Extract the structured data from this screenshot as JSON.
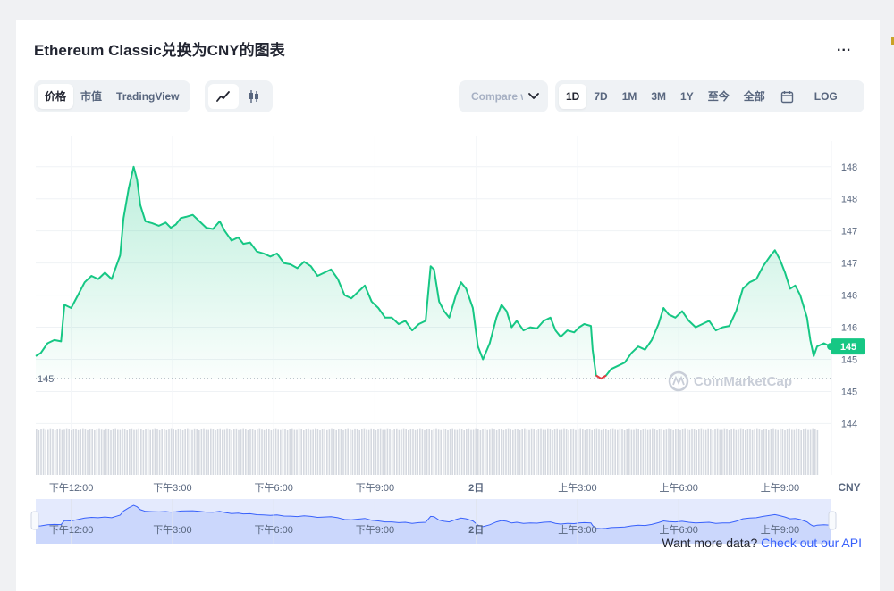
{
  "title": "Ethereum Classic兑换为CNY的图表",
  "more_label": "...",
  "type_tabs": [
    "价格",
    "市值",
    "TradingView"
  ],
  "compare_label": "Compare with",
  "range_tabs": [
    "1D",
    "7D",
    "1M",
    "3M",
    "1Y",
    "至今",
    "全部"
  ],
  "log_label": "LOG",
  "icons": {
    "line": "line-chart-icon",
    "candle": "candlestick-icon",
    "calendar": "calendar-icon",
    "chevron": "chevron-down-icon"
  },
  "colors": {
    "up": "#16c784",
    "down": "#ea3943",
    "accent": "#3861fb"
  },
  "footer": {
    "prefix": "Want more data? ",
    "link": "Check out our API"
  },
  "watermark": "CoinMarketCap",
  "chart_data": {
    "type": "area",
    "currency": "CNY",
    "y_ticks": [
      "148",
      "148",
      "147",
      "147",
      "146",
      "146",
      "145",
      "145",
      "144"
    ],
    "y_tick_values": [
      148.3,
      147.8,
      147.3,
      146.8,
      146.3,
      145.8,
      145.3,
      144.8,
      144.3
    ],
    "ylim": [
      144.0,
      148.7
    ],
    "baseline_label": "145",
    "baseline_value": 145.0,
    "current_label": "145",
    "x_ticks": [
      "下午12:00",
      "下午3:00",
      "下午6:00",
      "下午9:00",
      "2日",
      "上午3:00",
      "上午6:00",
      "上午9:00"
    ],
    "x_tick_hours": [
      2,
      5,
      8,
      11,
      14,
      17,
      20,
      23
    ],
    "x_range_hours": [
      0.95,
      24.1
    ],
    "grid": true,
    "series": [
      {
        "points": [
          [
            0.95,
            145.35
          ],
          [
            1.1,
            145.4
          ],
          [
            1.3,
            145.55
          ],
          [
            1.5,
            145.6
          ],
          [
            1.7,
            145.58
          ],
          [
            1.8,
            146.15
          ],
          [
            2.0,
            146.1
          ],
          [
            2.2,
            146.3
          ],
          [
            2.4,
            146.5
          ],
          [
            2.6,
            146.6
          ],
          [
            2.8,
            146.55
          ],
          [
            3.0,
            146.65
          ],
          [
            3.2,
            146.55
          ],
          [
            3.3,
            146.7
          ],
          [
            3.45,
            146.92
          ],
          [
            3.55,
            147.5
          ],
          [
            3.7,
            147.95
          ],
          [
            3.85,
            148.3
          ],
          [
            3.95,
            148.1
          ],
          [
            4.05,
            147.7
          ],
          [
            4.2,
            147.45
          ],
          [
            4.4,
            147.42
          ],
          [
            4.6,
            147.38
          ],
          [
            4.8,
            147.43
          ],
          [
            4.95,
            147.35
          ],
          [
            5.1,
            147.4
          ],
          [
            5.25,
            147.5
          ],
          [
            5.4,
            147.52
          ],
          [
            5.6,
            147.55
          ],
          [
            5.8,
            147.45
          ],
          [
            6.0,
            147.35
          ],
          [
            6.2,
            147.33
          ],
          [
            6.4,
            147.45
          ],
          [
            6.55,
            147.3
          ],
          [
            6.75,
            147.15
          ],
          [
            6.95,
            147.2
          ],
          [
            7.1,
            147.1
          ],
          [
            7.3,
            147.12
          ],
          [
            7.5,
            146.98
          ],
          [
            7.7,
            146.95
          ],
          [
            7.9,
            146.9
          ],
          [
            8.1,
            146.95
          ],
          [
            8.3,
            146.8
          ],
          [
            8.5,
            146.78
          ],
          [
            8.7,
            146.72
          ],
          [
            8.9,
            146.82
          ],
          [
            9.1,
            146.75
          ],
          [
            9.3,
            146.6
          ],
          [
            9.5,
            146.65
          ],
          [
            9.7,
            146.7
          ],
          [
            9.9,
            146.55
          ],
          [
            10.1,
            146.3
          ],
          [
            10.3,
            146.25
          ],
          [
            10.5,
            146.35
          ],
          [
            10.7,
            146.45
          ],
          [
            10.9,
            146.2
          ],
          [
            11.1,
            146.1
          ],
          [
            11.3,
            145.95
          ],
          [
            11.5,
            145.95
          ],
          [
            11.7,
            145.85
          ],
          [
            11.9,
            145.9
          ],
          [
            12.1,
            145.75
          ],
          [
            12.3,
            145.85
          ],
          [
            12.5,
            145.9
          ],
          [
            12.65,
            146.75
          ],
          [
            12.75,
            146.7
          ],
          [
            12.9,
            146.2
          ],
          [
            13.05,
            146.05
          ],
          [
            13.2,
            145.95
          ],
          [
            13.4,
            146.3
          ],
          [
            13.55,
            146.5
          ],
          [
            13.7,
            146.4
          ],
          [
            13.9,
            146.1
          ],
          [
            14.05,
            145.5
          ],
          [
            14.2,
            145.3
          ],
          [
            14.4,
            145.55
          ],
          [
            14.6,
            145.95
          ],
          [
            14.75,
            146.15
          ],
          [
            14.9,
            146.05
          ],
          [
            15.05,
            145.8
          ],
          [
            15.2,
            145.9
          ],
          [
            15.4,
            145.75
          ],
          [
            15.6,
            145.8
          ],
          [
            15.8,
            145.78
          ],
          [
            16.0,
            145.9
          ],
          [
            16.2,
            145.95
          ],
          [
            16.35,
            145.75
          ],
          [
            16.5,
            145.65
          ],
          [
            16.7,
            145.75
          ],
          [
            16.9,
            145.72
          ],
          [
            17.05,
            145.8
          ],
          [
            17.2,
            145.85
          ],
          [
            17.4,
            145.82
          ],
          [
            17.45,
            145.45
          ],
          [
            17.55,
            145.05
          ],
          [
            17.7,
            145.0
          ],
          [
            17.85,
            145.05
          ],
          [
            18.0,
            145.15
          ],
          [
            18.2,
            145.2
          ],
          [
            18.4,
            145.25
          ],
          [
            18.6,
            145.4
          ],
          [
            18.8,
            145.5
          ],
          [
            19.0,
            145.45
          ],
          [
            19.2,
            145.6
          ],
          [
            19.4,
            145.85
          ],
          [
            19.55,
            146.1
          ],
          [
            19.7,
            146.0
          ],
          [
            19.9,
            145.95
          ],
          [
            20.1,
            146.05
          ],
          [
            20.3,
            145.9
          ],
          [
            20.5,
            145.8
          ],
          [
            20.7,
            145.85
          ],
          [
            20.9,
            145.9
          ],
          [
            21.1,
            145.75
          ],
          [
            21.3,
            145.8
          ],
          [
            21.5,
            145.82
          ],
          [
            21.7,
            146.05
          ],
          [
            21.9,
            146.4
          ],
          [
            22.1,
            146.5
          ],
          [
            22.3,
            146.55
          ],
          [
            22.5,
            146.75
          ],
          [
            22.7,
            146.9
          ],
          [
            22.85,
            147.0
          ],
          [
            23.0,
            146.85
          ],
          [
            23.15,
            146.65
          ],
          [
            23.3,
            146.4
          ],
          [
            23.45,
            146.45
          ],
          [
            23.6,
            146.3
          ],
          [
            23.8,
            145.95
          ],
          [
            23.9,
            145.6
          ],
          [
            24.0,
            145.35
          ],
          [
            24.1,
            145.5
          ],
          [
            24.3,
            145.55
          ],
          [
            24.5,
            145.5
          ]
        ]
      }
    ]
  }
}
